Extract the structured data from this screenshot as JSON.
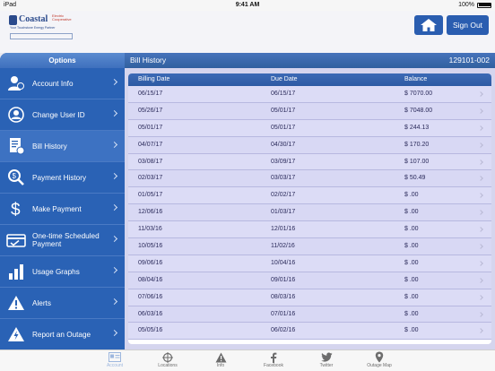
{
  "status_bar": {
    "carrier": "iPad",
    "time": "9:41 AM",
    "battery": "100%"
  },
  "header": {
    "logo": {
      "name": "Coastal",
      "subtitle": "Electric Cooperative",
      "tagline": "Your Touchstone Energy Partner"
    },
    "home_button_icon": "home-icon",
    "signout_label": "Sign Out",
    "accent_color": "#2a5db0"
  },
  "sidebar": {
    "title": "Options",
    "items": [
      {
        "label": "Account Info",
        "icon": "account-info-icon"
      },
      {
        "label": "Change User ID",
        "icon": "user-id-icon"
      },
      {
        "label": "Bill History",
        "icon": "bill-history-icon"
      },
      {
        "label": "Payment History",
        "icon": "payment-history-icon"
      },
      {
        "label": "Make Payment",
        "icon": "dollar-icon"
      },
      {
        "label": "One-time Scheduled Payment",
        "icon": "scheduled-payment-icon"
      },
      {
        "label": "Usage Graphs",
        "icon": "bar-graph-icon"
      },
      {
        "label": "Alerts",
        "icon": "alert-icon"
      },
      {
        "label": "Report an Outage",
        "icon": "outage-bolt-icon"
      }
    ]
  },
  "main": {
    "title": "Bill History",
    "account_number": "129101-002",
    "columns": [
      "Billing Date",
      "Due Date",
      "Balance"
    ],
    "rows": [
      [
        "06/15/17",
        "06/15/17",
        "$ 7070.00"
      ],
      [
        "05/26/17",
        "05/01/17",
        "$ 7048.00"
      ],
      [
        "05/01/17",
        "05/01/17",
        "$ 244.13"
      ],
      [
        "04/07/17",
        "04/30/17",
        "$ 170.20"
      ],
      [
        "03/08/17",
        "03/09/17",
        "$ 107.00"
      ],
      [
        "02/03/17",
        "03/03/17",
        "$ 50.49"
      ],
      [
        "01/05/17",
        "02/02/17",
        "$ .00"
      ],
      [
        "12/06/16",
        "01/03/17",
        "$ .00"
      ],
      [
        "11/03/16",
        "12/01/16",
        "$ .00"
      ],
      [
        "10/05/16",
        "11/02/16",
        "$ .00"
      ],
      [
        "09/06/16",
        "10/04/16",
        "$ .00"
      ],
      [
        "08/04/16",
        "09/01/16",
        "$ .00"
      ],
      [
        "07/06/16",
        "08/03/16",
        "$ .00"
      ],
      [
        "06/03/16",
        "07/01/16",
        "$ .00"
      ],
      [
        "05/05/16",
        "06/02/16",
        "$ .00"
      ]
    ]
  },
  "tabbar": {
    "tabs": [
      {
        "label": "Account",
        "icon": "account-card-icon"
      },
      {
        "label": "Locations",
        "icon": "locations-icon"
      },
      {
        "label": "Info",
        "icon": "info-warning-icon"
      },
      {
        "label": "Facebook",
        "icon": "facebook-icon"
      },
      {
        "label": "Twitter",
        "icon": "twitter-icon"
      },
      {
        "label": "Outage Map",
        "icon": "map-pin-icon"
      }
    ]
  }
}
